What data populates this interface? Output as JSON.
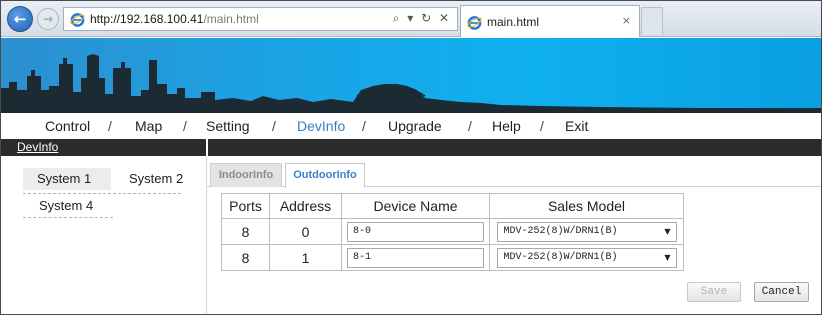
{
  "browser": {
    "url_host": "http://192.168.100.41",
    "url_path": "/main.html",
    "address_controls": "⌕ ▾ ↻ ✕",
    "tab_title": "main.html",
    "tab_close": "×",
    "back_glyph": "←",
    "forward_glyph": "→"
  },
  "menu": {
    "items": [
      "Control",
      "Map",
      "Setting",
      "DevInfo",
      "Upgrade",
      "Help",
      "Exit"
    ],
    "active": "DevInfo",
    "separator": "/"
  },
  "breadcrumb": "DevInfo",
  "sidebar": {
    "systems": [
      "System 1",
      "System 2",
      "System 4"
    ],
    "selected": "System 1"
  },
  "tabs": [
    "IndoorInfo",
    "OutdoorInfo"
  ],
  "active_tab": "OutdoorInfo",
  "table": {
    "headers": [
      "Ports",
      "Address",
      "Device Name",
      "Sales Model"
    ],
    "rows": [
      {
        "ports": "8",
        "address": "0",
        "device_name": "8-0",
        "sales_model": "MDV-252(8)W/DRN1(B)"
      },
      {
        "ports": "8",
        "address": "1",
        "device_name": "8-1",
        "sales_model": "MDV-252(8)W/DRN1(B)"
      }
    ]
  },
  "buttons": {
    "save": "Save",
    "cancel": "Cancel"
  },
  "colors": {
    "accent": "#3a7dc6",
    "banner": "#1aa4e5",
    "strip": "#2b2b2b"
  }
}
